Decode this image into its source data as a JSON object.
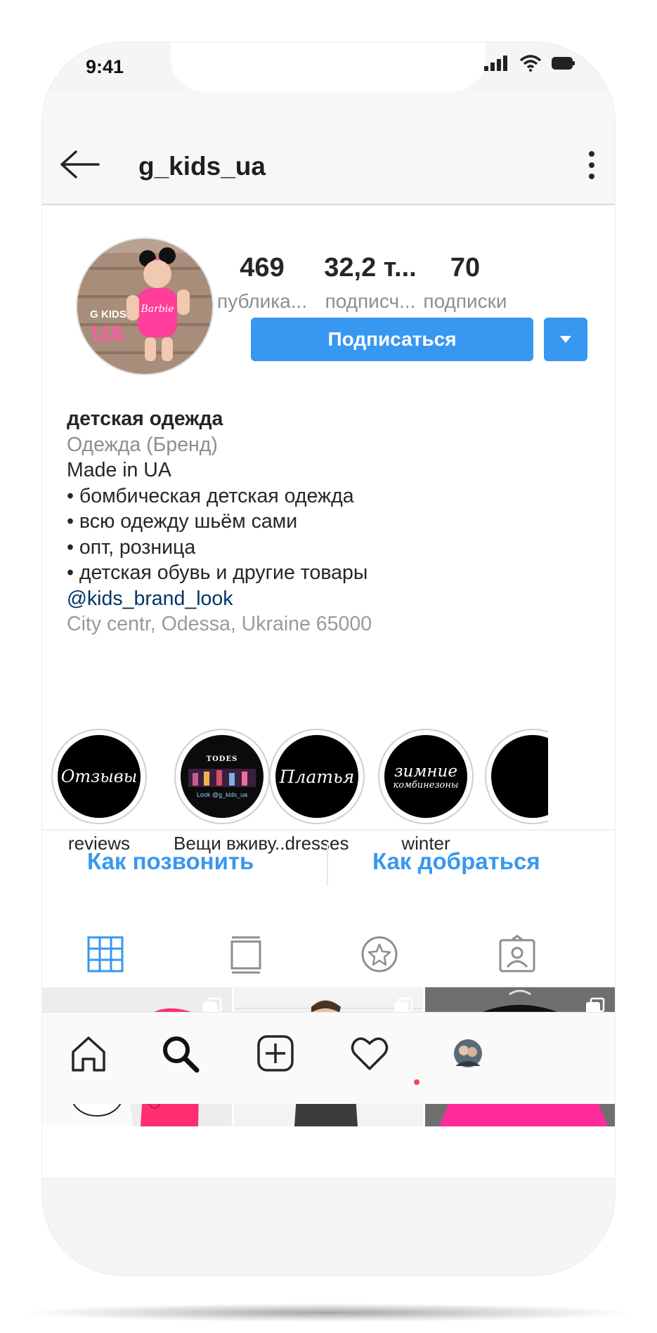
{
  "status_bar": {
    "time": "9:41"
  },
  "header": {
    "username": "g_kids_ua"
  },
  "profile": {
    "avatar_text_top": "G KIDS",
    "avatar_text_bottom": "UA",
    "avatar_shirt_text": "Barbie",
    "stats": [
      {
        "value": "469",
        "label": "публика..."
      },
      {
        "value": "32,2 т...",
        "label": "подписч..."
      },
      {
        "value": "70",
        "label": "подписки"
      }
    ],
    "follow_label": "Подписаться"
  },
  "bio": {
    "name": "детская одежда",
    "category": "Одежда (Бренд)",
    "lines": [
      "Made in UA",
      "• бомбическая детская одежда",
      "• всю одежду шьём сами",
      "• опт, розница",
      "• детская обувь и другие товары"
    ],
    "mention": "@kids_brand_look",
    "location": "City centr, Odessa, Ukraine 65000"
  },
  "highlights": [
    {
      "label": "reviews",
      "cover_text": "Отзывы"
    },
    {
      "label": "Вещи вживу...",
      "cover_text": "TODES",
      "cover_sub": "Look @g_kids_ua"
    },
    {
      "label": "dresses",
      "cover_text": "Платья"
    },
    {
      "label": "winter",
      "cover_text": "зимние",
      "cover_sub": "комбинезоны"
    }
  ],
  "contact": {
    "call": "Как позвонить",
    "directions": "Как добраться"
  },
  "colors": {
    "accent": "#3897f0",
    "notification": "#ed4956",
    "mention": "#003569"
  },
  "icons": {
    "tabs": [
      "grid-icon",
      "feed-icon",
      "guides-star-icon",
      "tagged-icon"
    ],
    "nav": [
      "home-icon",
      "search-icon",
      "add-icon",
      "heart-icon",
      "profile-icon"
    ]
  }
}
